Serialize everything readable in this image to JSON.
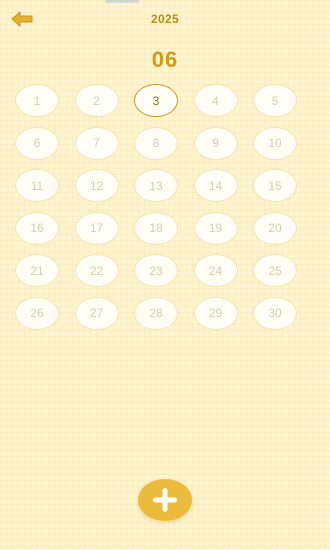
{
  "header": {
    "year": "2025",
    "back_icon": "arrow-left-icon"
  },
  "month": {
    "label": "06"
  },
  "days": [
    {
      "label": "1"
    },
    {
      "label": "2"
    },
    {
      "label": "3",
      "selected": true
    },
    {
      "label": "4"
    },
    {
      "label": "5"
    },
    {
      "label": "6"
    },
    {
      "label": "7"
    },
    {
      "label": "8"
    },
    {
      "label": "9"
    },
    {
      "label": "10"
    },
    {
      "label": "11"
    },
    {
      "label": "12"
    },
    {
      "label": "13"
    },
    {
      "label": "14"
    },
    {
      "label": "15"
    },
    {
      "label": "16"
    },
    {
      "label": "17"
    },
    {
      "label": "18"
    },
    {
      "label": "19"
    },
    {
      "label": "20"
    },
    {
      "label": "21"
    },
    {
      "label": "22"
    },
    {
      "label": "23"
    },
    {
      "label": "24"
    },
    {
      "label": "25"
    },
    {
      "label": "26"
    },
    {
      "label": "27"
    },
    {
      "label": "28"
    },
    {
      "label": "29"
    },
    {
      "label": "30"
    }
  ],
  "add_button": {
    "icon": "plus-icon"
  },
  "colors": {
    "accent": "#ebbb3b",
    "title": "#d09b13",
    "year": "#b98a12",
    "selected_border": "#c99a1e",
    "background": "#fdf4cf"
  }
}
